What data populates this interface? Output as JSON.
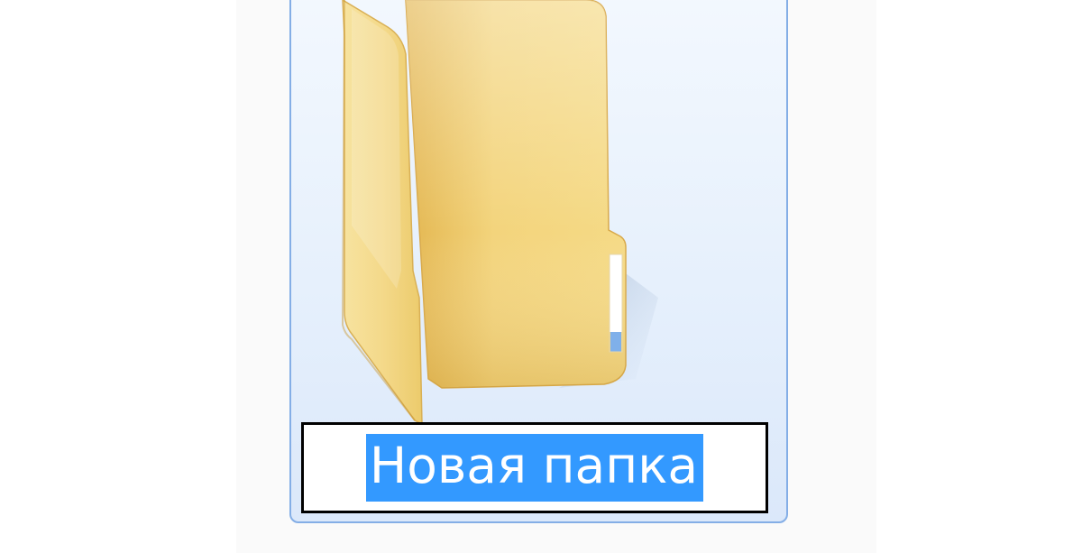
{
  "folder": {
    "name": "Новая папка",
    "icon": "folder-icon",
    "state": "renaming",
    "selected": true
  },
  "colors": {
    "selection_border": "#84aee6",
    "selection_fill": "#e6f0fc",
    "text_highlight": "#3399ff",
    "folder_yellow": "#f5d97e"
  }
}
